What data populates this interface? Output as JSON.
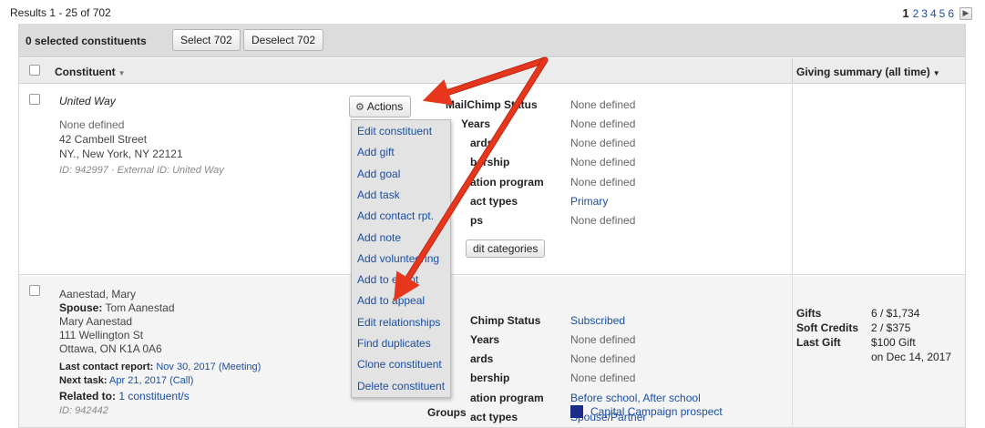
{
  "results": {
    "text": "Results 1 - 25 of 702"
  },
  "pagination": {
    "current": "1",
    "pages": [
      "2",
      "3",
      "4",
      "5",
      "6"
    ],
    "next_icon": "chevron-right-icon"
  },
  "bulk": {
    "selected_count": "0 selected constituents",
    "select_label": "Select 702",
    "deselect_label": "Deselect 702"
  },
  "columns": {
    "constituent": "Constituent",
    "giving": "Giving summary (all time)"
  },
  "row1": {
    "name": "United Way",
    "line1": "None defined",
    "line2": "42 Cambell Street",
    "line3": "NY., New York, NY 22121",
    "id_line": "ID: 942997 · External ID: United Way",
    "actions_label": "Actions",
    "attributes": [
      {
        "label": "MailChimp Status",
        "value": "None defined"
      },
      {
        "label": "Years",
        "value": "None defined"
      },
      {
        "label": "ards",
        "value": "None defined"
      },
      {
        "label": "bership",
        "value": "None defined"
      },
      {
        "label": "ation program",
        "value": "None defined"
      },
      {
        "label": "act types",
        "value": "Primary"
      },
      {
        "label": "ps",
        "value": "None defined"
      }
    ],
    "edit_categories": "dit categories"
  },
  "row2": {
    "name": "Aanestad, Mary",
    "spouse_label": "Spouse:",
    "spouse_value": "Tom Aanestad",
    "line1": "Mary Aanestad",
    "line2": "111 Wellington St",
    "line3": "Ottawa, ON K1A 0A6",
    "last_contact_label": "Last contact report:",
    "last_contact_value": "Nov 30, 2017 (Meeting)",
    "next_task_label": "Next task:",
    "next_task_value": "Apr 21, 2017 (Call)",
    "related_label": "Related to:",
    "related_value": "1 constituent/s",
    "id_line": "ID: 942442",
    "attributes": [
      {
        "label": "Chimp Status",
        "value": "Subscribed"
      },
      {
        "label": "Years",
        "value": "None defined"
      },
      {
        "label": "ards",
        "value": "None defined"
      },
      {
        "label": "bership",
        "value": "None defined"
      },
      {
        "label": "ation program",
        "value": "Before school, After school"
      },
      {
        "label": "act types",
        "value": "Spouse/Partner"
      },
      {
        "label": "Groups",
        "value": "Capital Campaign prospect"
      }
    ],
    "giving": {
      "gifts_label": "Gifts",
      "gifts_value": "6 / $1,734",
      "soft_label": "Soft Credits",
      "soft_value": "2 / $375",
      "last_label": "Last Gift",
      "last_value": "$100 Gift",
      "last_date": "on Dec 14, 2017"
    }
  },
  "actions_menu": [
    "Edit constituent",
    "Add gift",
    "Add goal",
    "Add task",
    "Add contact rpt.",
    "Add note",
    "Add volunteering",
    "Add to event",
    "Add to appeal",
    "Edit relationships",
    "Find duplicates",
    "Clone constituent",
    "Delete constituent"
  ],
  "colors": {
    "link": "#1a4ea3",
    "annotation_arrow": "#e8361c",
    "group_swatch": "#1b2c88",
    "toolbar": "#dcdcdc"
  },
  "icons": {
    "actions": "gear-icon",
    "sort": "caret-down-icon"
  }
}
